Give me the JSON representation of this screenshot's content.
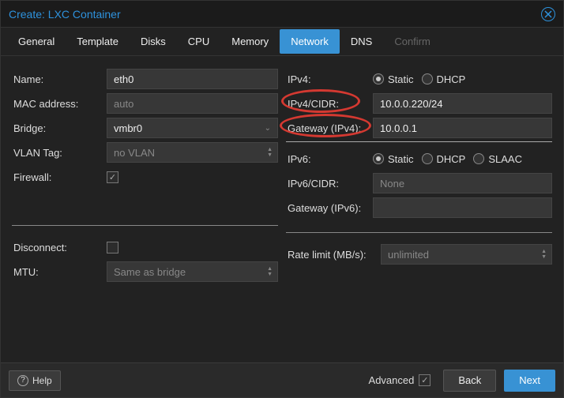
{
  "title": "Create: LXC Container",
  "tabs": [
    "General",
    "Template",
    "Disks",
    "CPU",
    "Memory",
    "Network",
    "DNS",
    "Confirm"
  ],
  "active_tab": "Network",
  "left": {
    "name_label": "Name:",
    "name_value": "eth0",
    "mac_label": "MAC address:",
    "mac_placeholder": "auto",
    "bridge_label": "Bridge:",
    "bridge_value": "vmbr0",
    "vlan_label": "VLAN Tag:",
    "vlan_placeholder": "no VLAN",
    "firewall_label": "Firewall:",
    "firewall_checked": true,
    "disconnect_label": "Disconnect:",
    "disconnect_checked": false,
    "mtu_label": "MTU:",
    "mtu_placeholder": "Same as bridge"
  },
  "right": {
    "ipv4_label": "IPv4:",
    "ipv4_options": [
      "Static",
      "DHCP"
    ],
    "ipv4_selected": "Static",
    "ipv4cidr_label": "IPv4/CIDR:",
    "ipv4cidr_value": "10.0.0.220/24",
    "gw4_label": "Gateway (IPv4):",
    "gw4_value": "10.0.0.1",
    "ipv6_label": "IPv6:",
    "ipv6_options": [
      "Static",
      "DHCP",
      "SLAAC"
    ],
    "ipv6_selected": "Static",
    "ipv6cidr_label": "IPv6/CIDR:",
    "ipv6cidr_placeholder": "None",
    "gw6_label": "Gateway (IPv6):",
    "gw6_value": "",
    "rate_label": "Rate limit (MB/s):",
    "rate_placeholder": "unlimited"
  },
  "footer": {
    "help": "Help",
    "advanced_label": "Advanced",
    "advanced_checked": true,
    "back": "Back",
    "next": "Next"
  }
}
